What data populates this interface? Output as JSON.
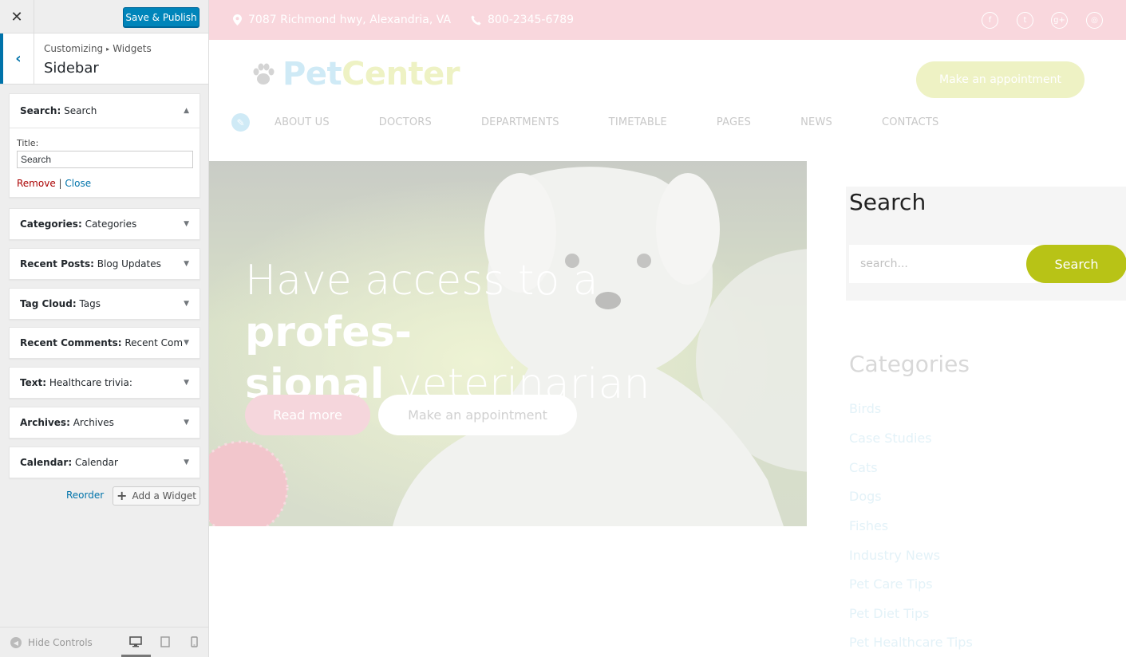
{
  "customizer": {
    "close_icon": "close-icon",
    "save_label": "Save & Publish",
    "breadcrumb": [
      "Customizing",
      "Widgets"
    ],
    "section_title": "Sidebar",
    "widgets": [
      {
        "type": "Search",
        "title": "Search",
        "open": true
      },
      {
        "type": "Categories",
        "title": "Categories"
      },
      {
        "type": "Recent Posts",
        "title": "Blog Updates"
      },
      {
        "type": "Tag Cloud",
        "title": "Tags"
      },
      {
        "type": "Recent Comments",
        "title": "Recent Com..."
      },
      {
        "type": "Text",
        "title": "Healthcare trivia:"
      },
      {
        "type": "Archives",
        "title": "Archives"
      },
      {
        "type": "Calendar",
        "title": "Calendar"
      }
    ],
    "search_widget_form": {
      "title_label": "Title:",
      "title_value": "Search",
      "remove_label": "Remove",
      "separator": "|",
      "close_label": "Close"
    },
    "reorder_label": "Reorder",
    "add_widget_label": "Add a Widget",
    "hide_controls_label": "Hide Controls"
  },
  "preview": {
    "topbar": {
      "address": "7087 Richmond hwy, Alexandria, VA",
      "phone": "800-2345-6789",
      "social": [
        "f",
        "t",
        "g+",
        "ig"
      ]
    },
    "logo": {
      "part1": "Pet",
      "part2": "Center"
    },
    "header_cta": "Make an appointment",
    "nav": [
      "ABOUT US",
      "DOCTORS",
      "DEPARTMENTS",
      "TIMETABLE",
      "PAGES",
      "NEWS",
      "CONTACTS"
    ],
    "hero": {
      "line1_light": "Have access to a ",
      "line1_bold": "profes-",
      "line2_bold": "sional",
      "line2_light": " veterinarian",
      "read_more": "Read more",
      "appointment": "Make an appointment"
    },
    "sidebar_search": {
      "title": "Search",
      "placeholder": "search...",
      "button": "Search"
    },
    "categories": {
      "title": "Categories",
      "items": [
        "Birds",
        "Case Studies",
        "Cats",
        "Dogs",
        "Fishes",
        "Industry News",
        "Pet Care Tips",
        "Pet Diet Tips",
        "Pet Healthcare Tips"
      ]
    }
  },
  "colors": {
    "wp_blue": "#0085ba",
    "topbar_pink": "#f9d7dd",
    "search_green": "#b8c316"
  }
}
